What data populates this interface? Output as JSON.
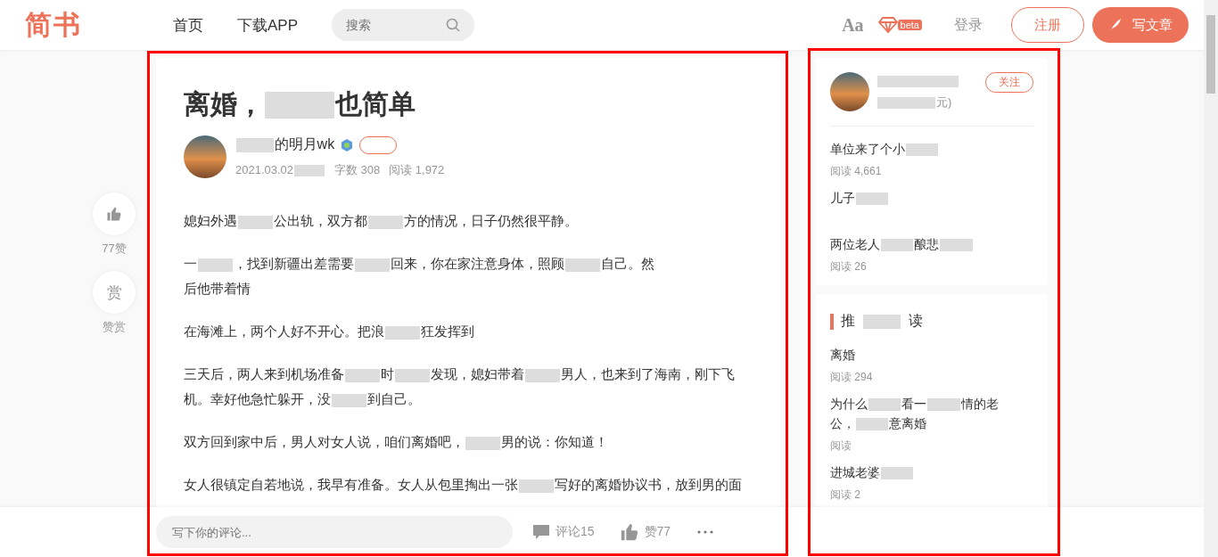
{
  "header": {
    "logo": "简书",
    "nav": [
      {
        "label": "首页"
      },
      {
        "label": "下载APP"
      }
    ],
    "search": {
      "placeholder": "搜索"
    },
    "font_toggle": "Aa",
    "beta_badge": "beta",
    "login": "登录",
    "register": "注册",
    "write": "写文章"
  },
  "side_actions": [
    {
      "kind": "like",
      "label": "77赞"
    },
    {
      "kind": "reward",
      "glyph": "赏",
      "label": "赞赏"
    }
  ],
  "article": {
    "title": [
      "离婚，",
      "也简单"
    ],
    "author": {
      "name": [
        "的明月wk"
      ],
      "leading_redaction": true
    },
    "meta": [
      [
        "2021.03.02"
      ],
      [
        "字数 308"
      ],
      [
        "阅读 1,972"
      ]
    ],
    "paragraphs": [
      [
        [
          "媳妇外遇",
          "公出轨，双方都",
          "方的情况，日子仍然很平静。"
        ]
      ],
      [
        [
          "一",
          "，找到新疆出差需要",
          "回来，你在家注意身体，照顾",
          "自己。然"
        ],
        [
          "后他带着情"
        ]
      ],
      [
        [
          "在海滩上，两个人好不开心。把浪",
          "狂发挥到"
        ]
      ],
      [
        [
          "三天后，两人来到机场准备",
          "时",
          "发现，媳妇带着",
          "男人，也来到了海南，刚下飞"
        ],
        [
          "机。幸好他急忙躲开，没",
          "到自己。"
        ]
      ],
      [
        [
          "双方回到家中后，男人对女人说，咱们离婚吧，",
          "男的说：你知道！"
        ]
      ],
      [
        [
          "女人很镇定自若地说，我早有准备。女人从包里掏出一张",
          "写好的离婚协议书，放到男的面"
        ]
      ]
    ]
  },
  "author_card": {
    "follow": "关注",
    "subtitle": [
      "元)"
    ],
    "articles": [
      {
        "title": [
          [
            "单位来了个小"
          ]
        ],
        "trailing_redaction": true,
        "reads": "阅读 4,661"
      },
      {
        "title": [
          [
            "儿子"
          ]
        ],
        "trailing_redaction": true
      },
      {
        "title": [
          [
            "两位老人",
            "酿悲"
          ]
        ],
        "trailing_redaction": true,
        "reads": "阅读 26"
      }
    ]
  },
  "recommended": {
    "heading": [
      "推",
      "读"
    ],
    "items": [
      {
        "title": [
          [
            "离婚"
          ]
        ],
        "trailing_redaction": false,
        "reads": "阅读 294"
      },
      {
        "title": [
          [
            "为什么",
            "看一",
            "情的老"
          ],
          [
            "公，",
            "意离婚"
          ]
        ],
        "trailing_redaction": false,
        "reads": "阅读"
      },
      {
        "title": [
          [
            "进城老婆"
          ]
        ],
        "trailing_redaction": true,
        "reads": "阅读 2"
      }
    ]
  },
  "bottom_bar": {
    "comment": {
      "placeholder": "写下你的评论..."
    },
    "comments": "评论15",
    "likes": "赞77"
  }
}
